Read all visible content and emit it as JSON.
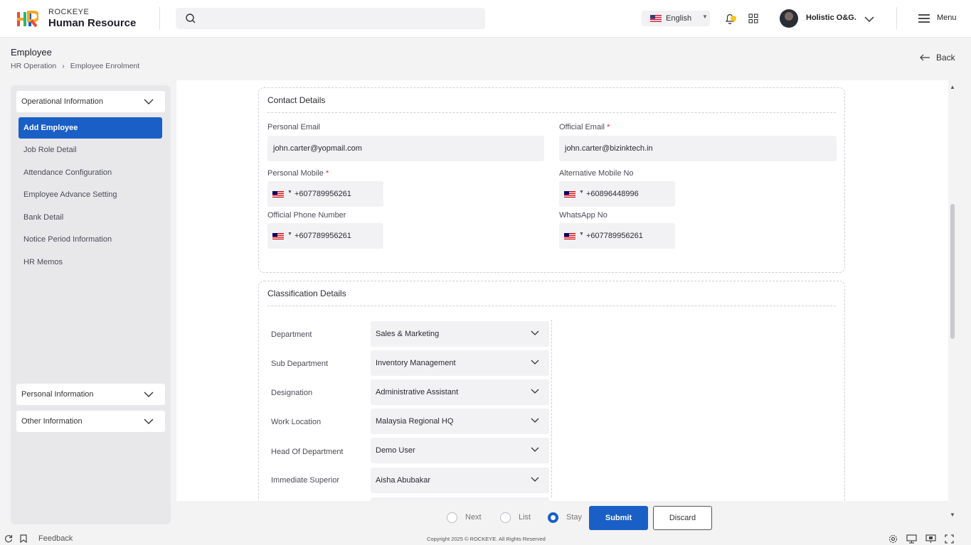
{
  "header": {
    "brand_small": "ROCKEYE",
    "brand_big": "Human Resource",
    "language": "English",
    "user_name": "Holistic O&G.",
    "menu_label": "Menu"
  },
  "page": {
    "title": "Employee",
    "breadcrumb": [
      "HR Operation",
      "Employee Enrolment"
    ],
    "back_label": "Back"
  },
  "sidebar": {
    "groups": {
      "operational": "Operational Information",
      "personal": "Personal Information",
      "other": "Other Information"
    },
    "active_item": "Add Employee",
    "items": [
      "Job Role Detail",
      "Attendance Configuration",
      "Employee Advance Setting",
      "Bank Detail",
      "Notice Period Information",
      "HR Memos"
    ]
  },
  "contact": {
    "title": "Contact Details",
    "personal_email": {
      "label": "Personal Email",
      "value": "john.carter@yopmail.com"
    },
    "official_email": {
      "label": "Official Email",
      "required": "*",
      "value": "john.carter@bizinktech.in"
    },
    "personal_mobile": {
      "label": "Personal Mobile",
      "required": "*",
      "value": "+607789956261"
    },
    "alt_mobile": {
      "label": "Alternative Mobile No",
      "value": "+60896448996"
    },
    "official_phone": {
      "label": "Official Phone Number",
      "value": "+607789956261"
    },
    "whatsapp": {
      "label": "WhatsApp No",
      "value": "+607789956261"
    }
  },
  "classification": {
    "title": "Classification Details",
    "fields": [
      {
        "label": "Department",
        "value": "Sales & Marketing"
      },
      {
        "label": "Sub Department",
        "value": "Inventory Management"
      },
      {
        "label": "Designation",
        "value": "Administrative Assistant"
      },
      {
        "label": "Work Location",
        "value": "Malaysia Regional HQ"
      },
      {
        "label": "Head Of Department",
        "value": "Demo User"
      },
      {
        "label": "Immediate Superior",
        "value": "Aisha Abubakar"
      }
    ]
  },
  "actions": {
    "next": "Next",
    "list": "List",
    "stay": "Stay",
    "selected": "Stay",
    "submit": "Submit",
    "discard": "Discard"
  },
  "footer": {
    "feedback": "Feedback",
    "copyright": "Copyright 2025 © ROCKEYE. All Rights Reserved"
  },
  "colors": {
    "accent": "#1a5fc6",
    "required": "#d7263d"
  }
}
